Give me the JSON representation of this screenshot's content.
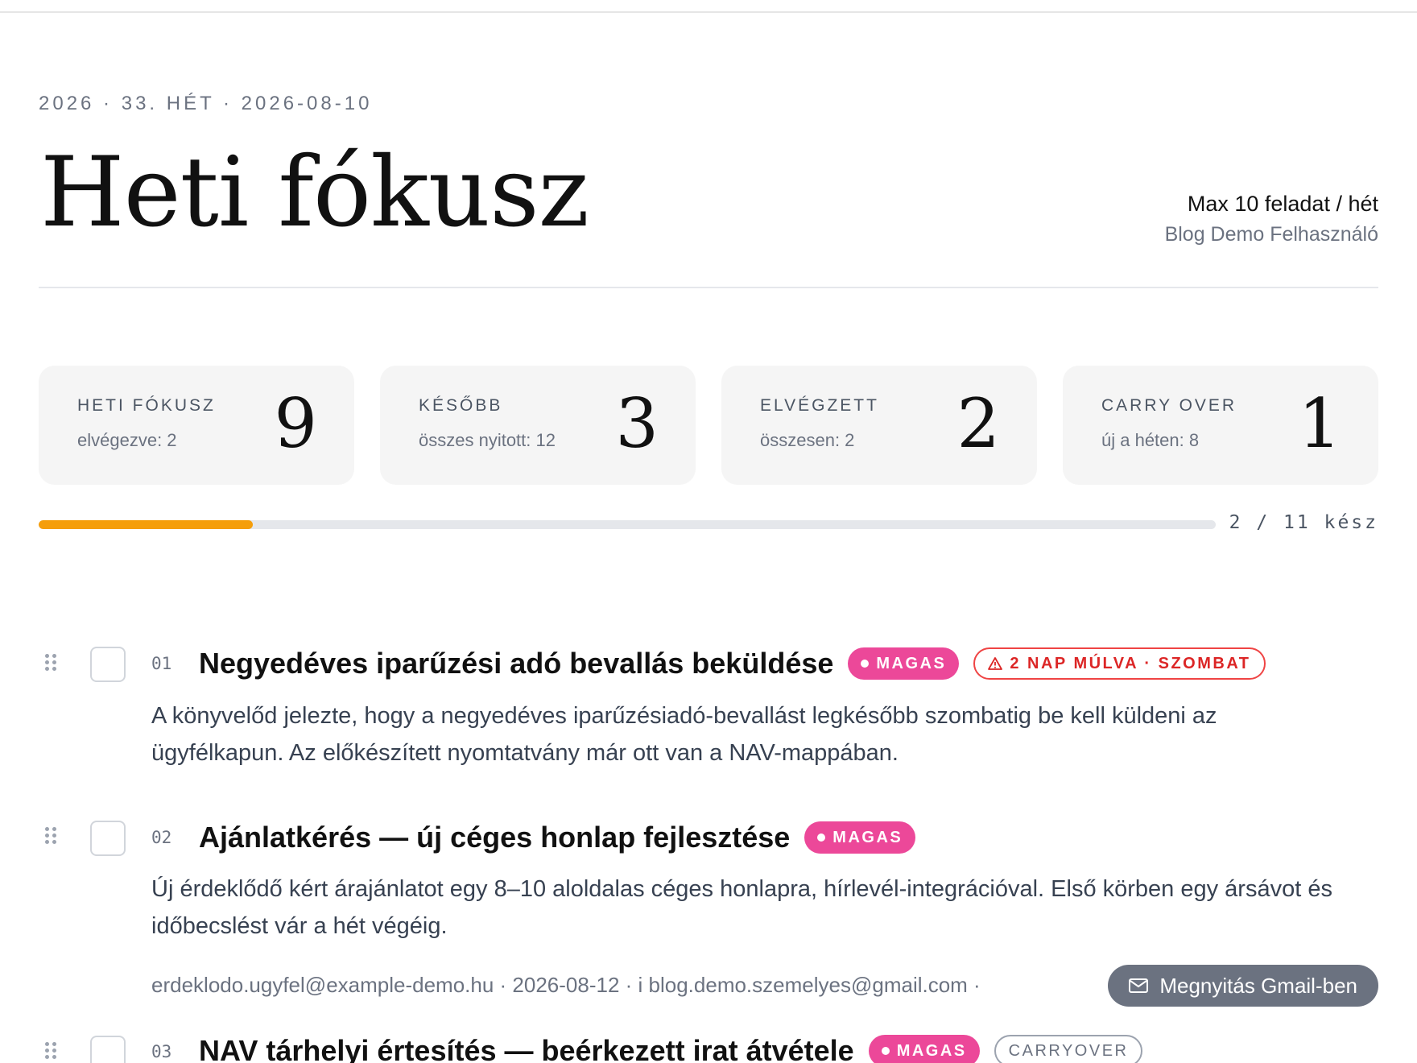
{
  "header": {
    "eyebrow": "2026 · 33. HÉT · 2026-08-10",
    "title": "Heti fókusz",
    "limit": "Max 10 feladat / hét",
    "user": "Blog Demo Felhasználó"
  },
  "stats": [
    {
      "label": "HETI FÓKUSZ",
      "sub": "elvégezve: 2",
      "value": "9"
    },
    {
      "label": "KÉSŐBB",
      "sub": "összes nyitott: 12",
      "value": "3"
    },
    {
      "label": "ELVÉGZETT",
      "sub": "összesen: 2",
      "value": "2"
    },
    {
      "label": "CARRY OVER",
      "sub": "új a héten: 8",
      "value": "1"
    }
  ],
  "progress": {
    "done": 2,
    "total": 11,
    "label": "2 / 11 kész",
    "color": "#f59e0b"
  },
  "tasks": [
    {
      "number": "01",
      "title": "Negyedéves iparűzési adó bevallás beküldése",
      "priority": "MAGAS",
      "deadline": "2 NAP MÚLVA · SZOMBAT",
      "description": "A könyvelőd jelezte, hogy a negyedéves iparűzésiadó-bevallást legkésőbb szombatig be kell küldeni az ügyfélkapun. Az előkészített nyomtatvány már ott van a NAV-mappában."
    },
    {
      "number": "02",
      "title": "Ajánlatkérés — új céges honlap fejlesztése",
      "priority": "MAGAS",
      "description": "Új érdeklődő kért árajánlatot egy 8–10 aloldalas céges honlapra, hírlevél-integrációval. Első körben egy ársávot és időbecslést vár a hét végéig.",
      "meta": "erdeklodo.ugyfel@example-demo.hu · 2026-08-12 · i blog.demo.szemelyes@gmail.com ·",
      "action": "Megnyitás Gmail-ben"
    },
    {
      "number": "03",
      "title": "NAV tárhelyi értesítés — beérkezett irat átvétele",
      "priority": "MAGAS",
      "tag": "CARRYOVER"
    }
  ],
  "colors": {
    "priority_high": "#ec4899",
    "deadline_warning": "#dc2626",
    "button": "#6b7280"
  },
  "icons": [
    "drag-handle-icon",
    "warning-icon",
    "mail-icon"
  ]
}
